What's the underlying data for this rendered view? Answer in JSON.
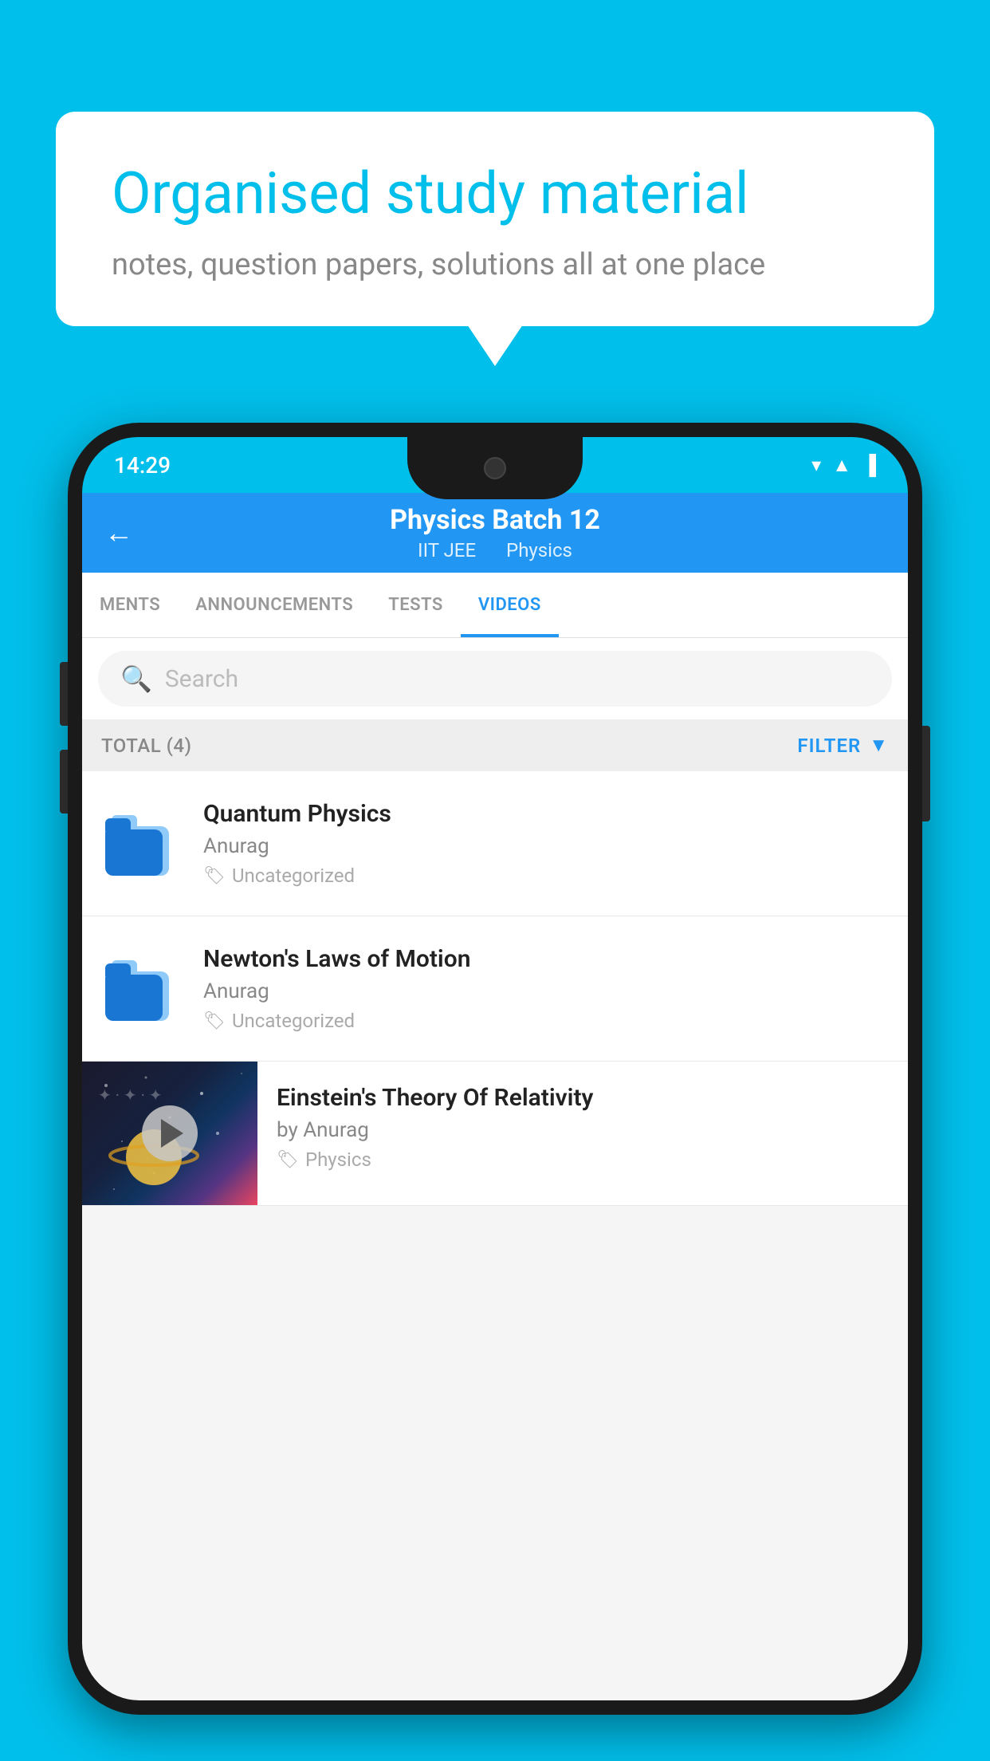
{
  "background_color": "#00BFEA",
  "speech_bubble": {
    "title": "Organised study material",
    "subtitle": "notes, question papers, solutions all at one place"
  },
  "phone": {
    "status_bar": {
      "time": "14:29",
      "icons": [
        "wifi",
        "signal",
        "battery"
      ]
    },
    "header": {
      "back_label": "←",
      "title": "Physics Batch 12",
      "subtitle_parts": [
        "IIT JEE",
        "Physics"
      ]
    },
    "tabs": [
      {
        "label": "MENTS",
        "active": false
      },
      {
        "label": "ANNOUNCEMENTS",
        "active": false
      },
      {
        "label": "TESTS",
        "active": false
      },
      {
        "label": "VIDEOS",
        "active": true
      }
    ],
    "search": {
      "placeholder": "Search"
    },
    "filter_row": {
      "total_label": "TOTAL (4)",
      "filter_label": "FILTER"
    },
    "videos": [
      {
        "id": 1,
        "title": "Quantum Physics",
        "author": "Anurag",
        "tag": "Uncategorized",
        "has_thumbnail": false
      },
      {
        "id": 2,
        "title": "Newton's Laws of Motion",
        "author": "Anurag",
        "tag": "Uncategorized",
        "has_thumbnail": false
      },
      {
        "id": 3,
        "title": "Einstein's Theory Of Relativity",
        "author": "by Anurag",
        "tag": "Physics",
        "has_thumbnail": true
      }
    ]
  }
}
